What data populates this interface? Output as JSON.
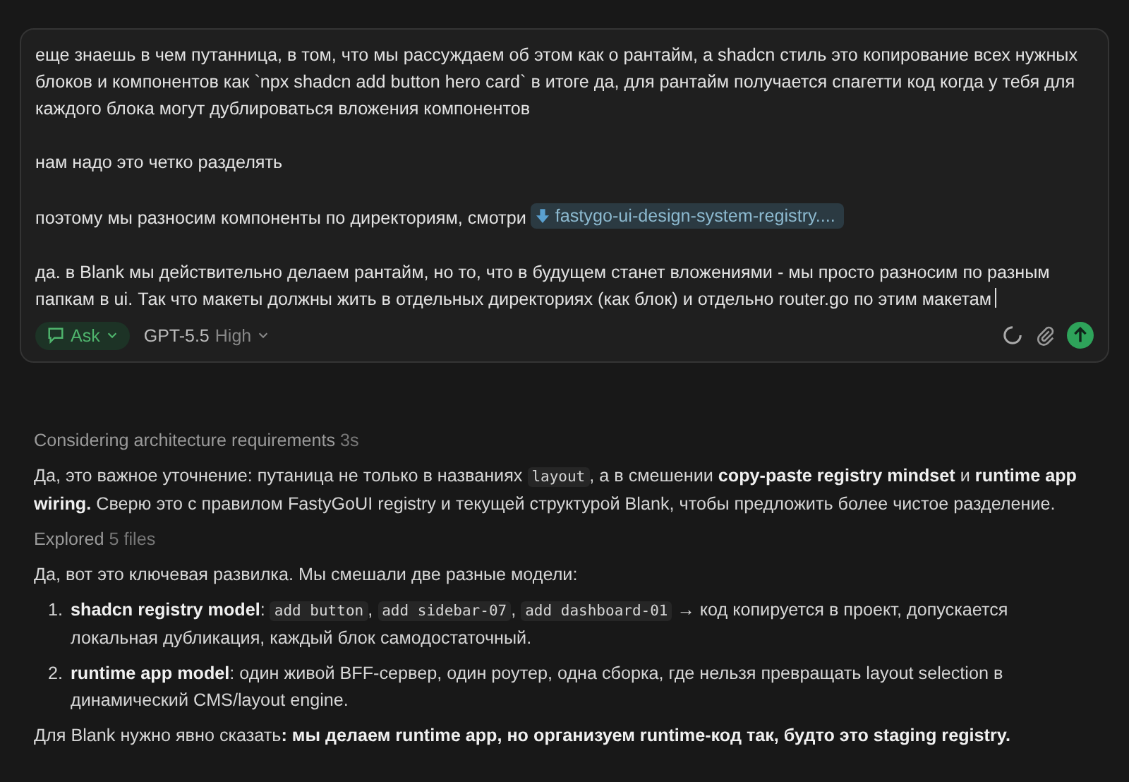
{
  "composer": {
    "paragraphs": [
      [
        {
          "kind": "plain",
          "text": "еще знаешь в чем путанница, в том, что мы рассуждаем об этом как о рантайм, а shadcn стиль это копирование всех нужных блоков и компонентов как `npx shadcn add button hero card` в итоге да, для рантайм получается спагетти код когда у тебя для каждого блока могут дублироваться вложения компонентов"
        }
      ],
      [
        {
          "kind": "plain",
          "text": "нам надо это четко разделять"
        }
      ],
      [
        {
          "kind": "plain",
          "text": "поэтому мы разносим компоненты по директориям, смотри "
        },
        {
          "kind": "chip",
          "text": "fastygo-ui-design-system-registry...."
        }
      ],
      [
        {
          "kind": "plain",
          "text": "да. в Blank мы действительно делаем рантайм, но то, что в будущем станет вложениями - мы просто разносим по разным папкам в ui. Так что макеты должны жить в отдельных директориях (как блок) и отдельно router.go по этим макетам"
        }
      ]
    ],
    "mode": "Ask",
    "model": "GPT-5.5",
    "effort": "High"
  },
  "response": [
    {
      "kind": "status",
      "label": "Considering architecture requirements",
      "detail": "3s"
    },
    {
      "kind": "paragraph",
      "segments": [
        {
          "kind": "plain",
          "text": "Да, это важное уточнение: путаница не только в названиях "
        },
        {
          "kind": "code",
          "text": "layout"
        },
        {
          "kind": "plain",
          "text": ", а в смешении "
        },
        {
          "kind": "bold",
          "text": "copy-paste registry mindset"
        },
        {
          "kind": "plain",
          "text": " и "
        },
        {
          "kind": "bold",
          "text": "runtime app wiring."
        },
        {
          "kind": "plain",
          "text": " Сверю это с правилом FastyGoUI registry и текущей структурой Blank, чтобы предложить более чистое разделение."
        }
      ]
    },
    {
      "kind": "status",
      "label": "Explored",
      "detail": "5 files"
    },
    {
      "kind": "paragraph",
      "segments": [
        {
          "kind": "plain",
          "text": "Да, вот это ключевая развилка. Мы смешали две разные модели:"
        }
      ]
    },
    {
      "kind": "list",
      "items": [
        {
          "marker": "1.",
          "segments": [
            {
              "kind": "bold",
              "text": "shadcn registry model"
            },
            {
              "kind": "plain",
              "text": ": "
            },
            {
              "kind": "code",
              "text": "add button"
            },
            {
              "kind": "plain",
              "text": ", "
            },
            {
              "kind": "code",
              "text": "add sidebar-07"
            },
            {
              "kind": "plain",
              "text": ", "
            },
            {
              "kind": "code",
              "text": "add dashboard-01"
            },
            {
              "kind": "plain",
              "text": " → код копируется в проект, допускается локальная дубликация, каждый блок самодостаточный."
            }
          ]
        },
        {
          "marker": "2.",
          "segments": [
            {
              "kind": "bold",
              "text": "runtime app model"
            },
            {
              "kind": "plain",
              "text": ": один живой BFF-сервер, один роутер, одна сборка, где нельзя превращать layout selection в динамический CMS/layout engine."
            }
          ]
        }
      ]
    },
    {
      "kind": "paragraph",
      "segments": [
        {
          "kind": "plain",
          "text": "Для Blank нужно явно сказать"
        },
        {
          "kind": "bold",
          "text": ": мы делаем runtime app, но организуем runtime-код так, будто это staging registry."
        }
      ]
    }
  ]
}
